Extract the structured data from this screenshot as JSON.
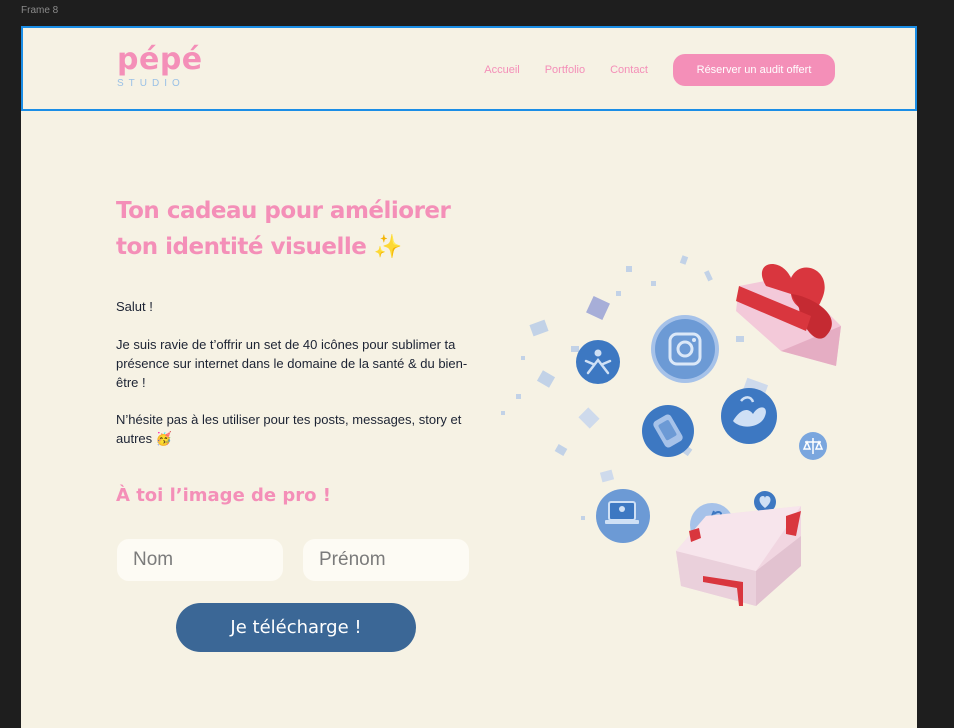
{
  "canvas": {
    "frame_label": "Frame 8"
  },
  "header": {
    "logo_main": "pépé",
    "logo_sub": "STUDIO",
    "nav": [
      "Accueil",
      "Portfolio",
      "Contact"
    ],
    "cta": "Réserver un audit offert"
  },
  "hero": {
    "title_line1": "Ton cadeau pour améliorer",
    "title_line2": "ton identité visuelle ✨",
    "greeting": "Salut !",
    "paragraph1": "Je suis ravie de t’offrir  un set de 40 icônes pour sublimer ta présence sur internet dans le domaine de la santé & du bien-être !",
    "paragraph2": "N’hésite pas à les utiliser pour tes posts, messages, story et autres 🥳",
    "subtitle": "À toi l’image de pro !"
  },
  "form": {
    "nom_placeholder": "Nom",
    "prenom_placeholder": "Prénom",
    "submit_label": "Je télécharge !"
  },
  "colors": {
    "background": "#f6f2e4",
    "pink": "#f48fb8",
    "blue_button": "#3b6796",
    "icon_blue": "#3d78c2",
    "ribbon_red": "#d9363e",
    "selection_blue": "#1b8ee6"
  },
  "illustration_icons": [
    "yoga-icon",
    "camera-icon",
    "phone-icon",
    "dove-hands-icon",
    "balance-icon",
    "laptop-icon",
    "apple-icon",
    "heart-icon",
    "gift-box-icon",
    "ribbon-bow-icon"
  ]
}
